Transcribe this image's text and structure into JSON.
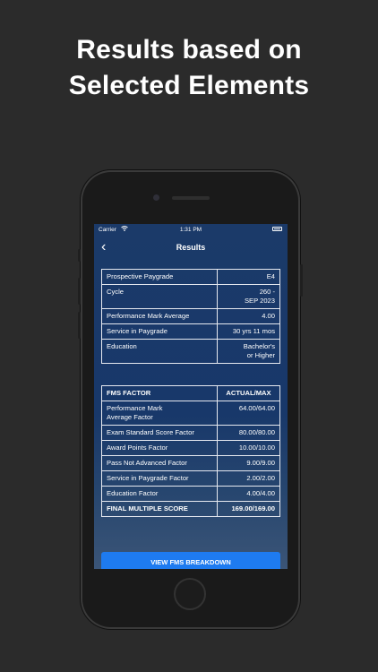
{
  "headline": {
    "line1": "Results based on",
    "line2": "Selected Elements"
  },
  "status_bar": {
    "carrier": "Carrier",
    "time": "1:31 PM"
  },
  "nav": {
    "back_icon": "chevron-left-icon",
    "back_glyph": "‹",
    "title": "Results"
  },
  "summary": [
    {
      "label": "Prospective Paygrade",
      "value": "E4"
    },
    {
      "label": "Cycle",
      "value": "260 -\nSEP 2023"
    },
    {
      "label": "Performance Mark Average",
      "value": "4.00"
    },
    {
      "label": "Service in Paygrade",
      "value": "30 yrs 11 mos"
    },
    {
      "label": "Education",
      "value": "Bachelor's\nor Higher"
    }
  ],
  "fms": {
    "header": {
      "factor": "FMS FACTOR",
      "actual": "ACTUAL/MAX"
    },
    "rows": [
      {
        "label": "Performance Mark\nAverage Factor",
        "value": "64.00/64.00"
      },
      {
        "label": "Exam Standard Score Factor",
        "value": "80.00/80.00"
      },
      {
        "label": "Award Points Factor",
        "value": "10.00/10.00"
      },
      {
        "label": "Pass Not Advanced Factor",
        "value": "9.00/9.00"
      },
      {
        "label": "Service in Paygrade Factor",
        "value": "2.00/2.00"
      },
      {
        "label": "Education Factor",
        "value": "4.00/4.00"
      }
    ],
    "final": {
      "label": "FINAL MULTIPLE SCORE",
      "value": "169.00/169.00"
    }
  },
  "actions": {
    "view_breakdown": "VIEW FMS BREAKDOWN"
  },
  "colors": {
    "background": "#2b2b2b",
    "screen": "#1b3a69",
    "accent": "#1e7bf0"
  }
}
